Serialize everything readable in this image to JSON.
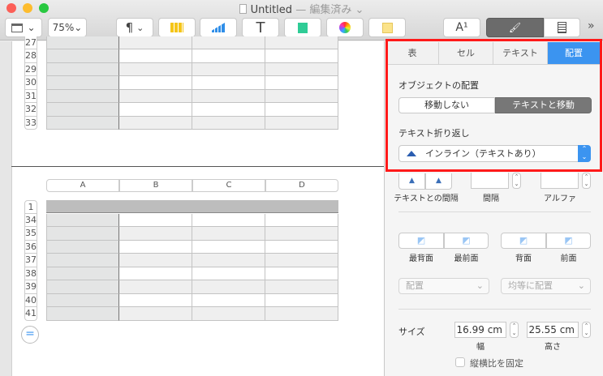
{
  "window": {
    "title": "Untitled",
    "status": "— 編集済み"
  },
  "toolbar": {
    "zoom": "75%",
    "paragraph": "¶",
    "font_size": "A¹",
    "more": "»"
  },
  "table_top": {
    "rows": [
      "27",
      "28",
      "29",
      "30",
      "31",
      "32",
      "33"
    ]
  },
  "table_bottom": {
    "columns": [
      "A",
      "B",
      "C",
      "D"
    ],
    "header_row": "1",
    "rows": [
      "34",
      "35",
      "36",
      "37",
      "38",
      "39",
      "40",
      "41"
    ]
  },
  "inspector": {
    "tabs": [
      {
        "label": "表"
      },
      {
        "label": "セル"
      },
      {
        "label": "テキスト"
      },
      {
        "label": "配置",
        "active": true
      }
    ],
    "object_placement": {
      "label": "オブジェクトの配置",
      "options": [
        "移動しない",
        "テキストと移動"
      ],
      "selected": "テキストと移動"
    },
    "text_wrap": {
      "label": "テキスト折り返し",
      "value": "インライン（テキストあり）"
    },
    "spacing": {
      "text_spacing_label": "テキストとの間隔",
      "spacing_label": "間隔",
      "alpha_label": "アルファ"
    },
    "layering": {
      "back": "最背面",
      "front": "最前面",
      "backward": "背面",
      "forward": "前面"
    },
    "align": {
      "align": "配置",
      "distribute": "均等に配置"
    },
    "size": {
      "label": "サイズ",
      "width": "16.99 cm",
      "width_label": "幅",
      "height": "25.55 cm",
      "height_label": "高さ",
      "constrain_label": "縦横比を固定"
    }
  },
  "colors": {
    "accent": "#3b94f0",
    "highlight": "#ff1a1a"
  }
}
